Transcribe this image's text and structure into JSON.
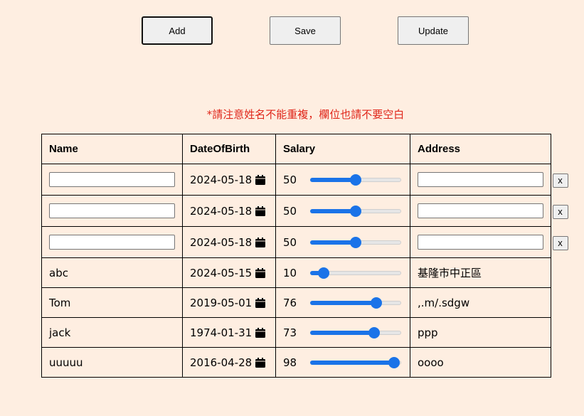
{
  "toolbar": {
    "add_label": "Add",
    "save_label": "Save",
    "update_label": "Update"
  },
  "notice": "*請注意姓名不能重複，欄位也請不要空白",
  "table": {
    "headers": [
      "Name",
      "DateOfBirth",
      "Salary",
      "Address"
    ],
    "edit_rows": [
      {
        "name": "",
        "date": "2024-05-18",
        "salary": 50,
        "address": "",
        "delete_label": "x"
      },
      {
        "name": "",
        "date": "2024-05-18",
        "salary": 50,
        "address": "",
        "delete_label": "x"
      },
      {
        "name": "",
        "date": "2024-05-18",
        "salary": 50,
        "address": "",
        "delete_label": "x"
      }
    ],
    "rows": [
      {
        "name": "abc",
        "date": "2024-05-15",
        "salary": 10,
        "address": "基隆市中正區"
      },
      {
        "name": "Tom",
        "date": "2019-05-01",
        "salary": 76,
        "address": ",.m/.sdgw"
      },
      {
        "name": "jack",
        "date": "1974-01-31",
        "salary": 73,
        "address": "ppp"
      },
      {
        "name": "uuuuu",
        "date": "2016-04-28",
        "salary": 98,
        "address": "oooo"
      }
    ],
    "salary_range": [
      0,
      100
    ]
  },
  "colors": {
    "background": "#feeee1",
    "notice": "#e0261a",
    "slider_accent": "#1a73e8"
  },
  "icons": {
    "date_picker": "calendar-icon"
  }
}
